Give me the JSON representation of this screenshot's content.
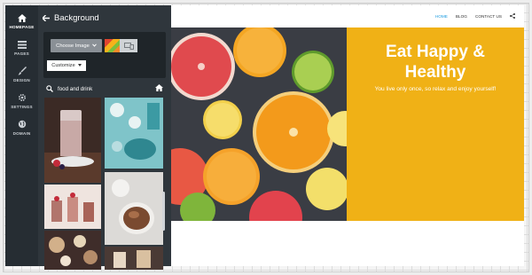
{
  "rail": {
    "items": [
      {
        "label": "HOMEPAGE",
        "icon": "home-icon",
        "active": true
      },
      {
        "label": "PAGES",
        "icon": "pages-icon"
      },
      {
        "label": "DESIGN",
        "icon": "brush-icon"
      },
      {
        "label": "SETTINGS",
        "icon": "gear-icon"
      },
      {
        "label": "DOMAIN",
        "icon": "globe-icon"
      }
    ]
  },
  "panel": {
    "title": "Background",
    "choose_label": "Choose Image",
    "customize_label": "Customize",
    "search_value": "food and drink"
  },
  "site": {
    "nav": [
      "HOME",
      "BLOG",
      "CONTACT US"
    ],
    "hero_title": "Eat Happy & Healthy",
    "hero_subtitle": "You live only once, so relax and enjoy yourself!"
  },
  "colors": {
    "rail_bg": "#262d33",
    "panel_bg": "#2f363c",
    "hero_accent": "#f0b116",
    "nav_active": "#1d9ce0"
  }
}
